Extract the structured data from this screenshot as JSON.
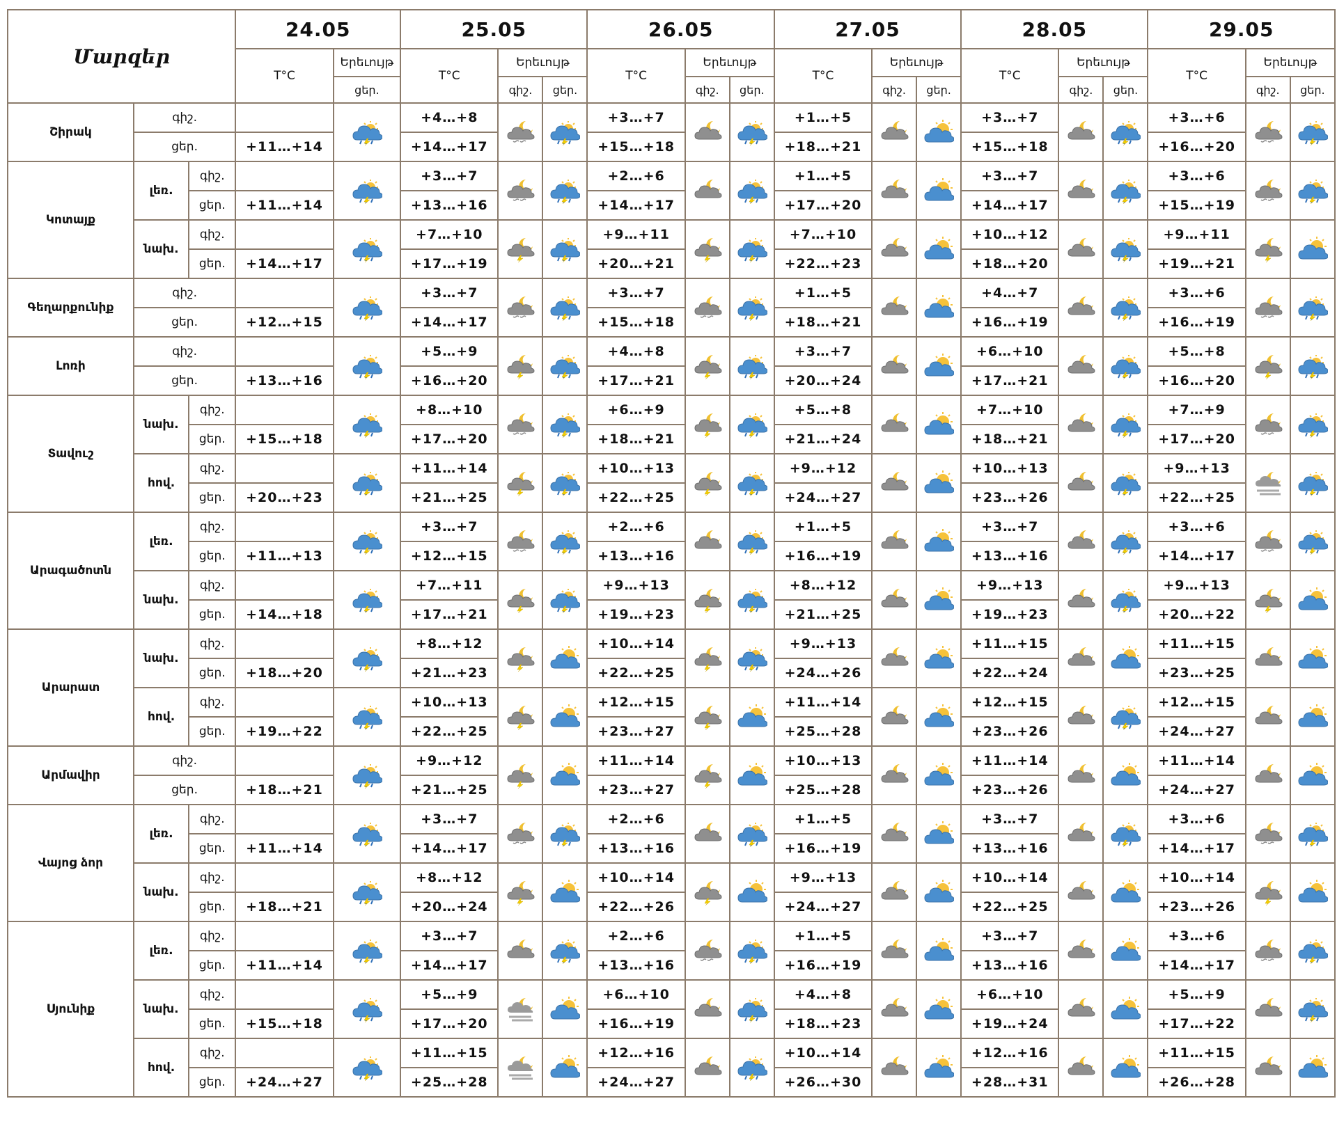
{
  "header": {
    "marz_label": "Մարզեր",
    "dates": [
      "24.05",
      "25.05",
      "26.05",
      "27.05",
      "28.05",
      "29.05"
    ],
    "temp_label": "T°C",
    "phenomenon_label": "Երեւույթ",
    "night_label": "գիշ.",
    "day_label": "ցեր."
  },
  "icon_legend": {
    "A": "sun-cloud-rain-lightning-icon",
    "B": "moon-cloud-rain-icon",
    "C": "moon-cloud-icon",
    "D": "sun-cloud-icon",
    "E": "moon-cloud-rain-lightning-icon",
    "F": "moon-cloud-fog-icon"
  },
  "forecast": [
    {
      "region": "Շիրակ",
      "zones": [
        {
          "zone": "",
          "d0": "+11…+14",
          "i0": "A",
          "days": [
            {
              "n": "+4…+8",
              "d": "+14…+17",
              "in": "B",
              "id": "A"
            },
            {
              "n": "+3…+7",
              "d": "+15…+18",
              "in": "C",
              "id": "A"
            },
            {
              "n": "+1…+5",
              "d": "+18…+21",
              "in": "C",
              "id": "D"
            },
            {
              "n": "+3…+7",
              "d": "+15…+18",
              "in": "C",
              "id": "A"
            },
            {
              "n": "+3…+6",
              "d": "+16…+20",
              "in": "B",
              "id": "A"
            }
          ]
        }
      ]
    },
    {
      "region": "Կոտայք",
      "zones": [
        {
          "zone": "լեռ.",
          "d0": "+11…+14",
          "i0": "A",
          "days": [
            {
              "n": "+3…+7",
              "d": "+13…+16",
              "in": "B",
              "id": "A"
            },
            {
              "n": "+2…+6",
              "d": "+14…+17",
              "in": "C",
              "id": "A"
            },
            {
              "n": "+1…+5",
              "d": "+17…+20",
              "in": "C",
              "id": "D"
            },
            {
              "n": "+3…+7",
              "d": "+14…+17",
              "in": "C",
              "id": "A"
            },
            {
              "n": "+3…+6",
              "d": "+15…+19",
              "in": "B",
              "id": "A"
            }
          ]
        },
        {
          "zone": "նախ.",
          "d0": "+14…+17",
          "i0": "A",
          "days": [
            {
              "n": "+7…+10",
              "d": "+17…+19",
              "in": "E",
              "id": "A"
            },
            {
              "n": "+9…+11",
              "d": "+20…+21",
              "in": "E",
              "id": "A"
            },
            {
              "n": "+7…+10",
              "d": "+22…+23",
              "in": "C",
              "id": "D"
            },
            {
              "n": "+10…+12",
              "d": "+18…+20",
              "in": "C",
              "id": "A"
            },
            {
              "n": "+9…+11",
              "d": "+19…+21",
              "in": "E",
              "id": "D"
            }
          ]
        }
      ]
    },
    {
      "region": "Գեղարքունիք",
      "zones": [
        {
          "zone": "",
          "d0": "+12…+15",
          "i0": "A",
          "days": [
            {
              "n": "+3…+7",
              "d": "+14…+17",
              "in": "B",
              "id": "A"
            },
            {
              "n": "+3…+7",
              "d": "+15…+18",
              "in": "B",
              "id": "A"
            },
            {
              "n": "+1…+5",
              "d": "+18…+21",
              "in": "C",
              "id": "D"
            },
            {
              "n": "+4…+7",
              "d": "+16…+19",
              "in": "C",
              "id": "A"
            },
            {
              "n": "+3…+6",
              "d": "+16…+19",
              "in": "B",
              "id": "A"
            }
          ]
        }
      ]
    },
    {
      "region": "Լոռի",
      "zones": [
        {
          "zone": "",
          "d0": "+13…+16",
          "i0": "A",
          "days": [
            {
              "n": "+5…+9",
              "d": "+16…+20",
              "in": "E",
              "id": "A"
            },
            {
              "n": "+4…+8",
              "d": "+17…+21",
              "in": "E",
              "id": "A"
            },
            {
              "n": "+3…+7",
              "d": "+20…+24",
              "in": "C",
              "id": "D"
            },
            {
              "n": "+6…+10",
              "d": "+17…+21",
              "in": "C",
              "id": "A"
            },
            {
              "n": "+5…+8",
              "d": "+16…+20",
              "in": "E",
              "id": "A"
            }
          ]
        }
      ]
    },
    {
      "region": "Տավուշ",
      "zones": [
        {
          "zone": "նախ.",
          "d0": "+15…+18",
          "i0": "A",
          "days": [
            {
              "n": "+8…+10",
              "d": "+17…+20",
              "in": "B",
              "id": "A"
            },
            {
              "n": "+6…+9",
              "d": "+18…+21",
              "in": "E",
              "id": "A"
            },
            {
              "n": "+5…+8",
              "d": "+21…+24",
              "in": "C",
              "id": "D"
            },
            {
              "n": "+7…+10",
              "d": "+18…+21",
              "in": "C",
              "id": "A"
            },
            {
              "n": "+7…+9",
              "d": "+17…+20",
              "in": "B",
              "id": "A"
            }
          ]
        },
        {
          "zone": "հով.",
          "d0": "+20…+23",
          "i0": "A",
          "days": [
            {
              "n": "+11…+14",
              "d": "+21…+25",
              "in": "E",
              "id": "A"
            },
            {
              "n": "+10…+13",
              "d": "+22…+25",
              "in": "E",
              "id": "A"
            },
            {
              "n": "+9…+12",
              "d": "+24…+27",
              "in": "C",
              "id": "D"
            },
            {
              "n": "+10…+13",
              "d": "+23…+26",
              "in": "C",
              "id": "A"
            },
            {
              "n": "+9…+13",
              "d": "+22…+25",
              "in": "F",
              "id": "A"
            }
          ]
        }
      ]
    },
    {
      "region": "Արագածոտն",
      "zones": [
        {
          "zone": "լեռ.",
          "d0": "+11…+13",
          "i0": "A",
          "days": [
            {
              "n": "+3…+7",
              "d": "+12…+15",
              "in": "B",
              "id": "A"
            },
            {
              "n": "+2…+6",
              "d": "+13…+16",
              "in": "C",
              "id": "A"
            },
            {
              "n": "+1…+5",
              "d": "+16…+19",
              "in": "C",
              "id": "D"
            },
            {
              "n": "+3…+7",
              "d": "+13…+16",
              "in": "C",
              "id": "A"
            },
            {
              "n": "+3…+6",
              "d": "+14…+17",
              "in": "B",
              "id": "A"
            }
          ]
        },
        {
          "zone": "նախ.",
          "d0": "+14…+18",
          "i0": "A",
          "days": [
            {
              "n": "+7…+11",
              "d": "+17…+21",
              "in": "E",
              "id": "A"
            },
            {
              "n": "+9…+13",
              "d": "+19…+23",
              "in": "E",
              "id": "A"
            },
            {
              "n": "+8…+12",
              "d": "+21…+25",
              "in": "C",
              "id": "D"
            },
            {
              "n": "+9…+13",
              "d": "+19…+23",
              "in": "C",
              "id": "A"
            },
            {
              "n": "+9…+13",
              "d": "+20…+22",
              "in": "E",
              "id": "D"
            }
          ]
        }
      ]
    },
    {
      "region": "Արարատ",
      "zones": [
        {
          "zone": "նախ.",
          "d0": "+18…+20",
          "i0": "A",
          "days": [
            {
              "n": "+8…+12",
              "d": "+21…+23",
              "in": "E",
              "id": "D"
            },
            {
              "n": "+10…+14",
              "d": "+22…+25",
              "in": "E",
              "id": "A"
            },
            {
              "n": "+9…+13",
              "d": "+24…+26",
              "in": "C",
              "id": "D"
            },
            {
              "n": "+11…+15",
              "d": "+22…+24",
              "in": "C",
              "id": "D"
            },
            {
              "n": "+11…+15",
              "d": "+23…+25",
              "in": "C",
              "id": "D"
            }
          ]
        },
        {
          "zone": "հով.",
          "d0": "+19…+22",
          "i0": "A",
          "days": [
            {
              "n": "+10…+13",
              "d": "+22…+25",
              "in": "E",
              "id": "D"
            },
            {
              "n": "+12…+15",
              "d": "+23…+27",
              "in": "E",
              "id": "D"
            },
            {
              "n": "+11…+14",
              "d": "+25…+28",
              "in": "C",
              "id": "D"
            },
            {
              "n": "+12…+15",
              "d": "+23…+26",
              "in": "C",
              "id": "A"
            },
            {
              "n": "+12…+15",
              "d": "+24…+27",
              "in": "C",
              "id": "D"
            }
          ]
        }
      ]
    },
    {
      "region": "Արմավիր",
      "zones": [
        {
          "zone": "",
          "d0": "+18…+21",
          "i0": "A",
          "days": [
            {
              "n": "+9…+12",
              "d": "+21…+25",
              "in": "E",
              "id": "D"
            },
            {
              "n": "+11…+14",
              "d": "+23…+27",
              "in": "E",
              "id": "D"
            },
            {
              "n": "+10…+13",
              "d": "+25…+28",
              "in": "C",
              "id": "D"
            },
            {
              "n": "+11…+14",
              "d": "+23…+26",
              "in": "C",
              "id": "D"
            },
            {
              "n": "+11…+14",
              "d": "+24…+27",
              "in": "C",
              "id": "D"
            }
          ]
        }
      ]
    },
    {
      "region": "Վայոց ձոր",
      "zones": [
        {
          "zone": "լեռ.",
          "d0": "+11…+14",
          "i0": "A",
          "days": [
            {
              "n": "+3…+7",
              "d": "+14…+17",
              "in": "B",
              "id": "A"
            },
            {
              "n": "+2…+6",
              "d": "+13…+16",
              "in": "C",
              "id": "A"
            },
            {
              "n": "+1…+5",
              "d": "+16…+19",
              "in": "C",
              "id": "D"
            },
            {
              "n": "+3…+7",
              "d": "+13…+16",
              "in": "C",
              "id": "A"
            },
            {
              "n": "+3…+6",
              "d": "+14…+17",
              "in": "B",
              "id": "A"
            }
          ]
        },
        {
          "zone": "նախ.",
          "d0": "+18…+21",
          "i0": "A",
          "days": [
            {
              "n": "+8…+12",
              "d": "+20…+24",
              "in": "E",
              "id": "D"
            },
            {
              "n": "+10…+14",
              "d": "+22…+26",
              "in": "E",
              "id": "D"
            },
            {
              "n": "+9…+13",
              "d": "+24…+27",
              "in": "C",
              "id": "D"
            },
            {
              "n": "+10…+14",
              "d": "+22…+25",
              "in": "C",
              "id": "D"
            },
            {
              "n": "+10…+14",
              "d": "+23…+26",
              "in": "E",
              "id": "D"
            }
          ]
        }
      ]
    },
    {
      "region": "Սյունիք",
      "zones": [
        {
          "zone": "լեռ.",
          "d0": "+11…+14",
          "i0": "A",
          "days": [
            {
              "n": "+3…+7",
              "d": "+14…+17",
              "in": "C",
              "id": "A"
            },
            {
              "n": "+2…+6",
              "d": "+13…+16",
              "in": "B",
              "id": "A"
            },
            {
              "n": "+1…+5",
              "d": "+16…+19",
              "in": "C",
              "id": "D"
            },
            {
              "n": "+3…+7",
              "d": "+13…+16",
              "in": "C",
              "id": "D"
            },
            {
              "n": "+3…+6",
              "d": "+14…+17",
              "in": "B",
              "id": "A"
            }
          ]
        },
        {
          "zone": "նախ.",
          "d0": "+15…+18",
          "i0": "A",
          "days": [
            {
              "n": "+5…+9",
              "d": "+17…+20",
              "in": "F",
              "id": "D"
            },
            {
              "n": "+6…+10",
              "d": "+16…+19",
              "in": "C",
              "id": "A"
            },
            {
              "n": "+4…+8",
              "d": "+18…+23",
              "in": "C",
              "id": "D"
            },
            {
              "n": "+6…+10",
              "d": "+19…+24",
              "in": "C",
              "id": "D"
            },
            {
              "n": "+5…+9",
              "d": "+17…+22",
              "in": "C",
              "id": "A"
            }
          ]
        },
        {
          "zone": "հով.",
          "d0": "+24…+27",
          "i0": "A",
          "days": [
            {
              "n": "+11…+15",
              "d": "+25…+28",
              "in": "F",
              "id": "D"
            },
            {
              "n": "+12…+16",
              "d": "+24…+27",
              "in": "C",
              "id": "A"
            },
            {
              "n": "+10…+14",
              "d": "+26…+30",
              "in": "C",
              "id": "D"
            },
            {
              "n": "+12…+16",
              "d": "+28…+31",
              "in": "C",
              "id": "D"
            },
            {
              "n": "+11…+15",
              "d": "+26…+28",
              "in": "C",
              "id": "D"
            }
          ]
        }
      ]
    }
  ]
}
